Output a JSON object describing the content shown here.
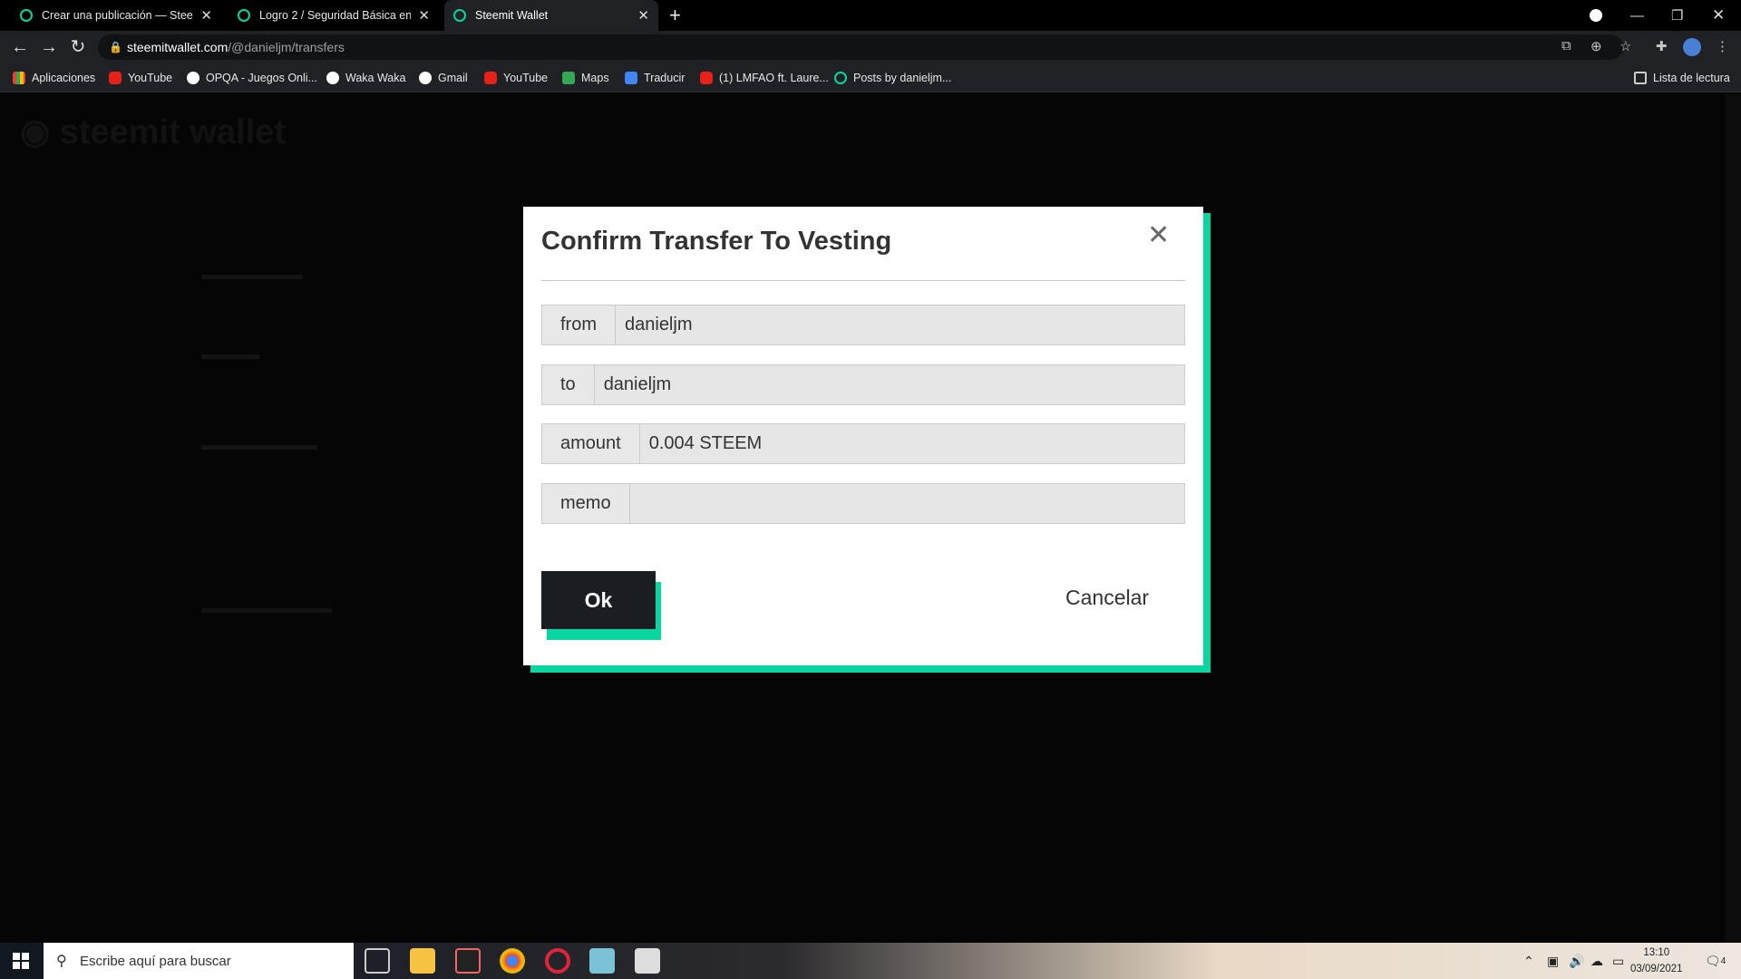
{
  "browser": {
    "tabs": [
      {
        "title": "Crear una publicación — Steemit",
        "active": false
      },
      {
        "title": "Logro 2 / Seguridad Básica en St",
        "active": false
      },
      {
        "title": "Steemit Wallet",
        "active": true
      }
    ],
    "url_host": "steemitwallet.com",
    "url_path": "/@danieljm/transfers",
    "bookmarks": [
      {
        "label": "Aplicaciones",
        "icon": "apps-grid-icon"
      },
      {
        "label": "YouTube",
        "icon": "youtube-icon"
      },
      {
        "label": "OPQA - Juegos Onli...",
        "icon": "opqa-icon"
      },
      {
        "label": "Waka Waka",
        "icon": "globe-icon"
      },
      {
        "label": "Gmail",
        "icon": "google-icon"
      },
      {
        "label": "YouTube",
        "icon": "youtube-icon"
      },
      {
        "label": "Maps",
        "icon": "maps-icon"
      },
      {
        "label": "Traducir",
        "icon": "translate-icon"
      },
      {
        "label": "(1) LMFAO ft. Laure...",
        "icon": "youtube-icon"
      },
      {
        "label": "Posts by danieljm...",
        "icon": "steemit-icon"
      }
    ],
    "reading_list": "Lista de lectura"
  },
  "modal": {
    "title": "Confirm Transfer To Vesting",
    "fields": [
      {
        "label": "from",
        "value": "danieljm"
      },
      {
        "label": "to",
        "value": "danieljm"
      },
      {
        "label": "amount",
        "value": "0.004 STEEM"
      },
      {
        "label": "memo",
        "value": ""
      }
    ],
    "ok_label": "Ok",
    "cancel_label": "Cancelar",
    "accent_color": "#07d6a0"
  },
  "taskbar": {
    "search_placeholder": "Escribe aquí para buscar",
    "time": "13:10",
    "date": "03/09/2021",
    "notification_count": "4"
  }
}
